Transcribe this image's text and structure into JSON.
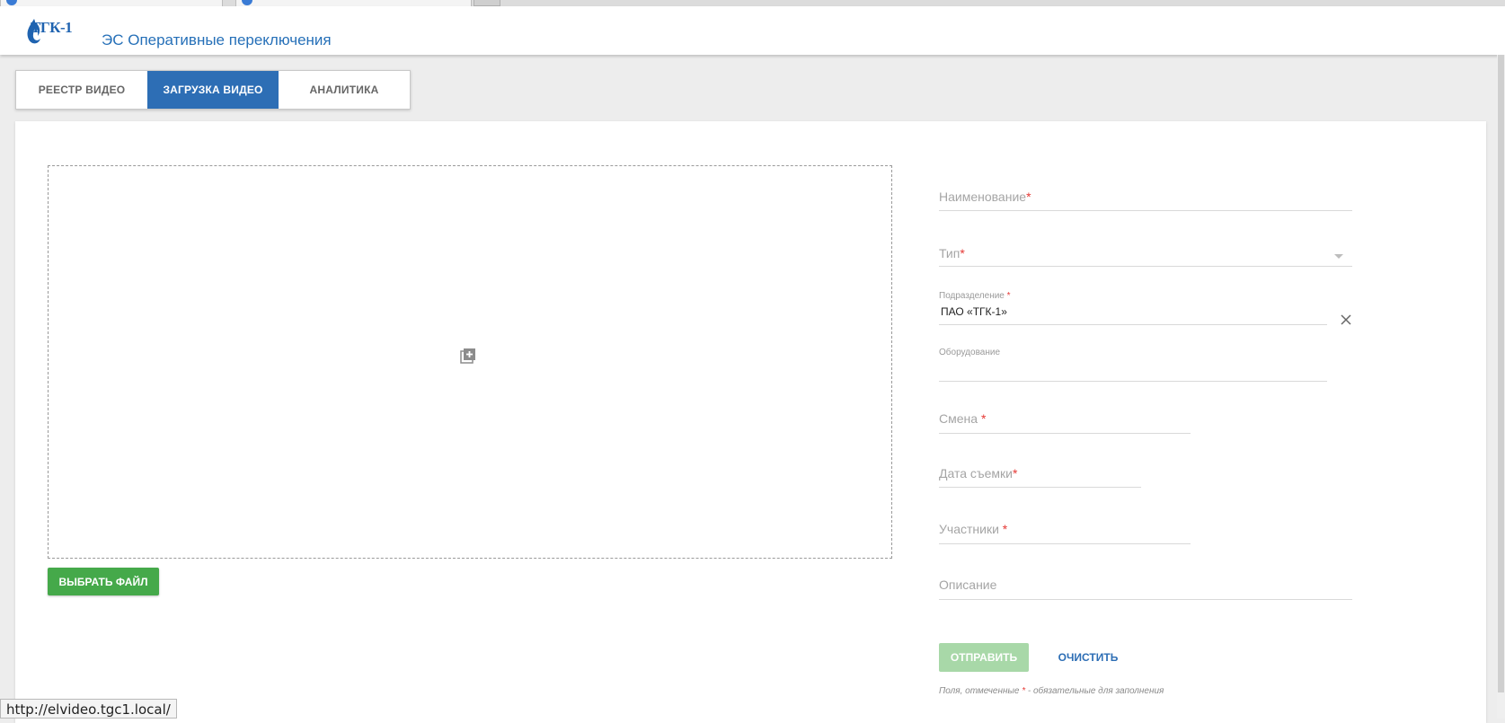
{
  "header": {
    "logo_text": "ТГК-1",
    "app_title": "ЭС Оперативные переключения"
  },
  "tabs": [
    {
      "label": "РЕЕСТР ВИДЕО",
      "active": false
    },
    {
      "label": "ЗАГРУЗКА ВИДЕО",
      "active": true
    },
    {
      "label": "АНАЛИТИКА",
      "active": false
    }
  ],
  "upload": {
    "dropzone_icon": "add-to-queue-icon",
    "choose_file_label": "ВЫБРАТЬ ФАЙЛ"
  },
  "form": {
    "name_placeholder": "Наименование",
    "type_placeholder": "Тип",
    "division_label": "Подразделение",
    "division_value": "ПАО «ТГК-1»",
    "equipment_label": "Оборудование",
    "shift_placeholder": "Смена",
    "date_placeholder": "Дата съемки",
    "participants_placeholder": "Участники",
    "description_placeholder": "Описание",
    "required_mark": "*",
    "submit_label": "ОТПРАВИТЬ",
    "reset_label": "ОЧИСТИТЬ",
    "hint_prefix": "Поля, отмеченные ",
    "hint_suffix": " - обязательные для заполнения"
  },
  "status_url": "http://elvideo.tgc1.local/",
  "colors": {
    "primary": "#2d6eb5",
    "success": "#45a94a",
    "success_disabled": "#a8d8a8",
    "required": "#e53935"
  }
}
